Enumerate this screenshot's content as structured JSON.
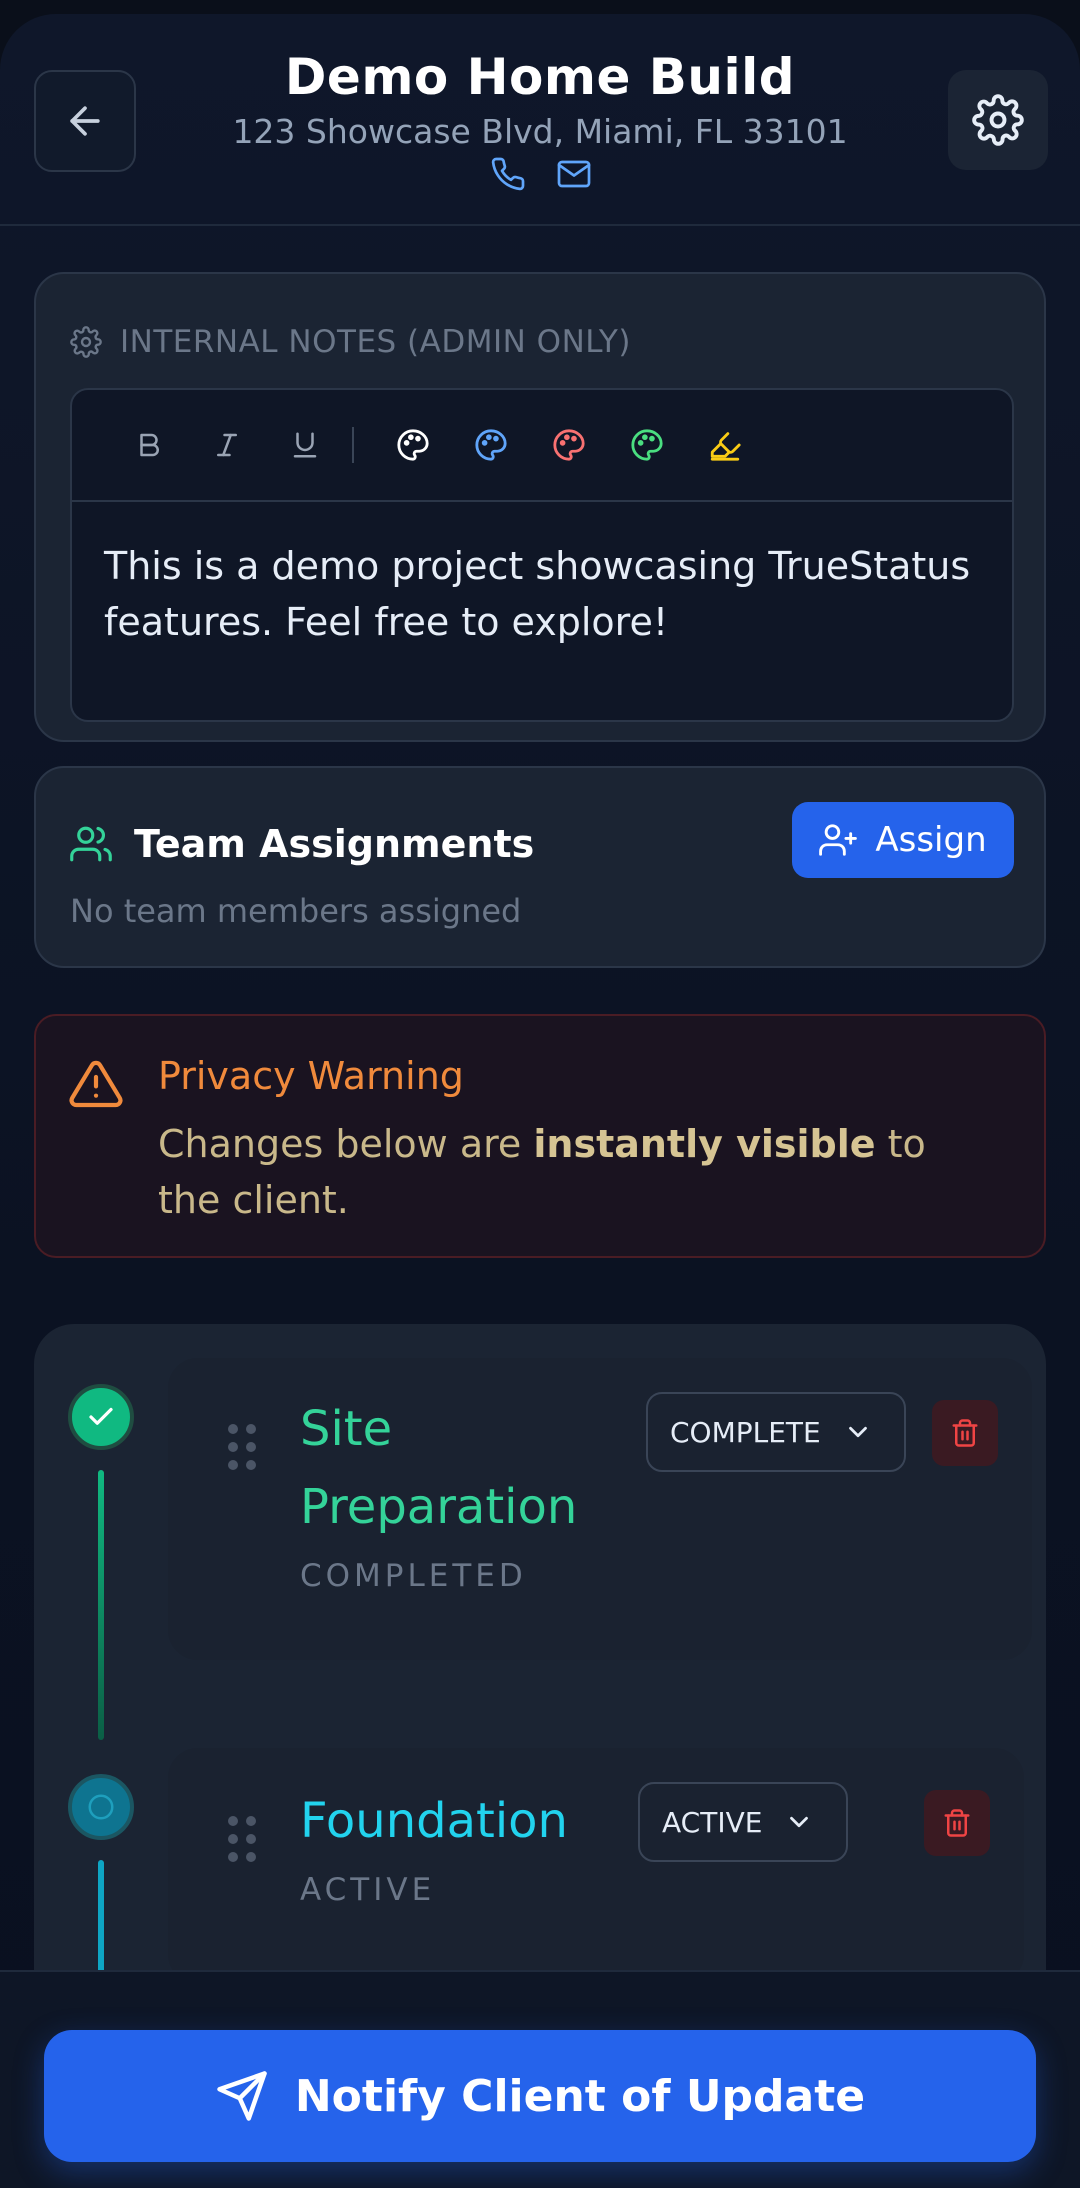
{
  "header": {
    "title": "Demo Home Build",
    "address": "123 Showcase Blvd, Miami, FL 33101",
    "icons": [
      "arrow-left-icon",
      "gear-icon",
      "phone-icon",
      "mail-icon"
    ]
  },
  "notes": {
    "heading": "INTERNAL NOTES (ADMIN ONLY)",
    "toolbar": [
      "bold",
      "italic",
      "underline",
      "palette-white",
      "palette-blue",
      "palette-red",
      "palette-green",
      "highlighter-yellow"
    ],
    "text": "This is a demo project showcasing TrueStatus features. Feel free to explore!"
  },
  "team": {
    "heading": "Team Assignments",
    "empty_text": "No team members assigned",
    "assign_label": "Assign"
  },
  "warning": {
    "title": "Privacy Warning",
    "text_before": "Changes below are ",
    "text_bold": "instantly visible",
    "text_after": " to the client."
  },
  "phases": [
    {
      "name": "Site Preparation",
      "state": "COMPLETED",
      "status_value": "COMPLETE",
      "color": "#34d399"
    },
    {
      "name": "Foundation",
      "state": "ACTIVE",
      "status_value": "ACTIVE",
      "color": "#22d3ee"
    }
  ],
  "footer": {
    "notify_label": "Notify Client of Update"
  },
  "colors": {
    "accent": "#2563eb",
    "complete": "#10b981",
    "active": "#22d3ee",
    "warning": "#f08a3c",
    "danger": "#ef4444"
  }
}
